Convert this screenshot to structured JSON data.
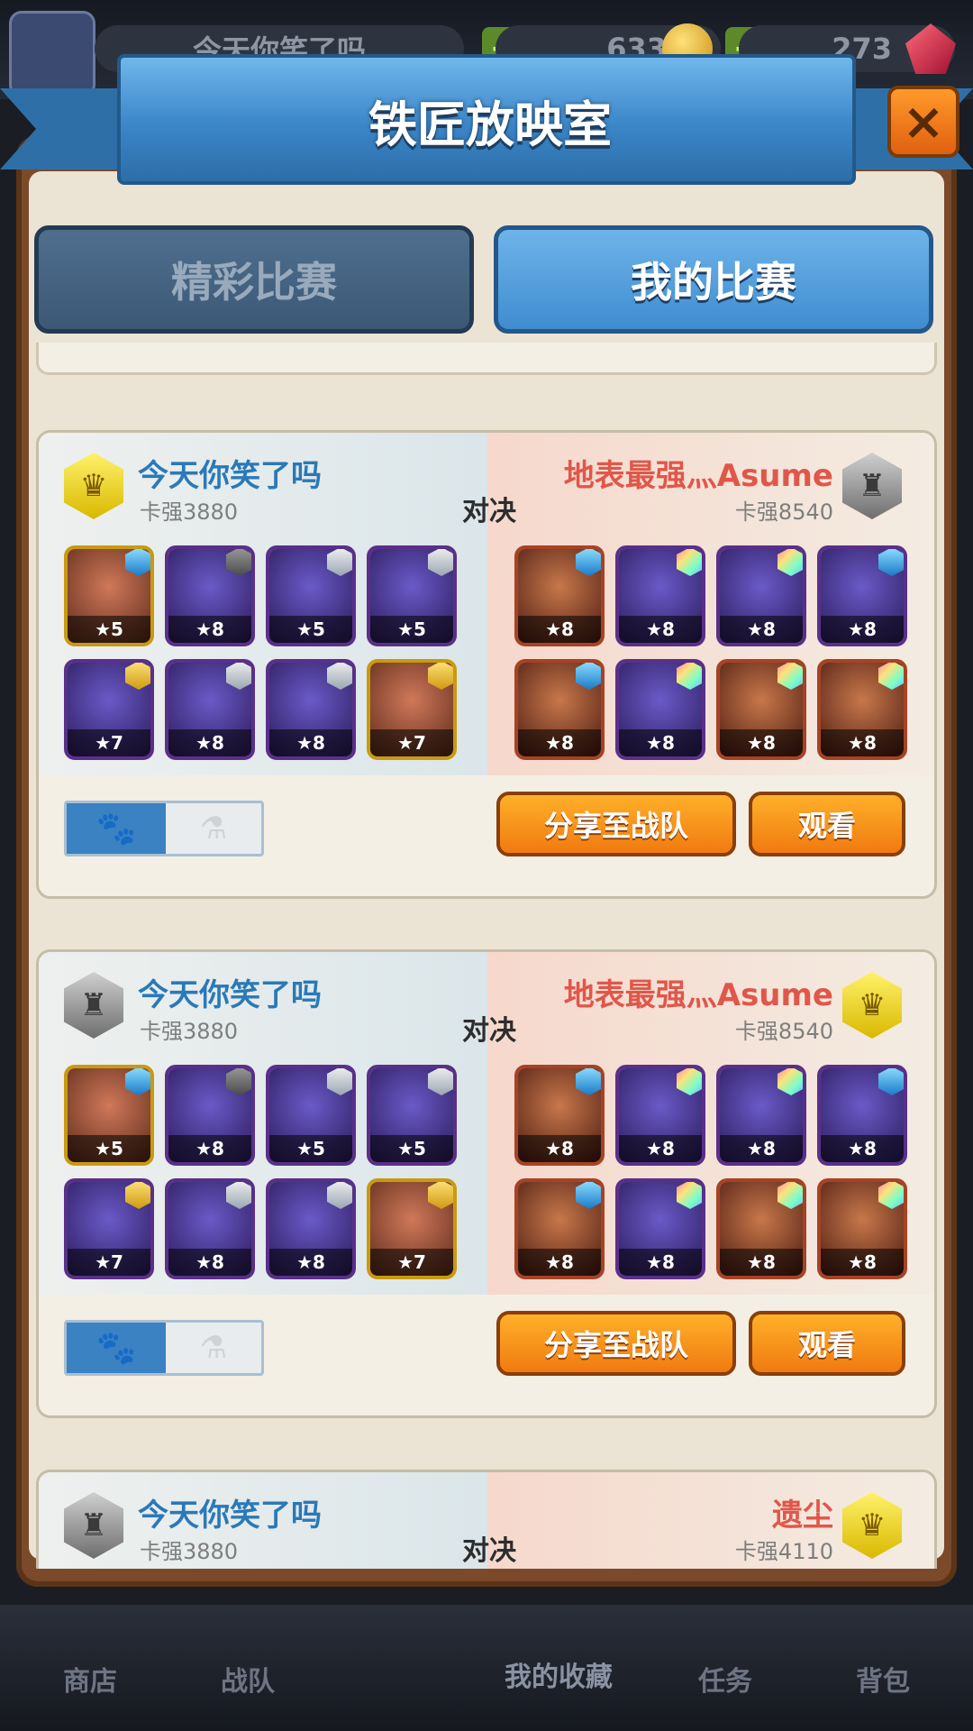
{
  "hud": {
    "player_name": "今天你笑了吗",
    "gold": "633",
    "gems": "273"
  },
  "window": {
    "title": "铁匠放映室",
    "close_icon": "×"
  },
  "tabs": [
    {
      "label": "精彩比赛",
      "active": false
    },
    {
      "label": "我的比赛",
      "active": true
    }
  ],
  "matches": [
    {
      "left": {
        "name": "今天你笑了吗",
        "power": "卡强3880",
        "badge": "gold-crown",
        "heroes": [
          {
            "level": "★5",
            "frame": "gold",
            "gem": "blue-star"
          },
          {
            "level": "★8",
            "frame": "purple",
            "gem": "gray"
          },
          {
            "level": "★5",
            "frame": "purple",
            "gem": "silver"
          },
          {
            "level": "★5",
            "frame": "purple",
            "gem": "silver"
          },
          {
            "level": "★7",
            "frame": "purple",
            "gem": "gold"
          },
          {
            "level": "★8",
            "frame": "purple",
            "gem": "silver"
          },
          {
            "level": "★8",
            "frame": "purple",
            "gem": "silver"
          },
          {
            "level": "★7",
            "frame": "gold",
            "gem": "gold"
          }
        ]
      },
      "vs": "对决",
      "right": {
        "name": "地表最强灬Asume",
        "power": "卡强8540",
        "badge": "silver-wings",
        "heroes": [
          {
            "level": "★8",
            "frame": "red",
            "gem": "blue-star"
          },
          {
            "level": "★8",
            "frame": "purple",
            "gem": "rainbow"
          },
          {
            "level": "★8",
            "frame": "purple",
            "gem": "rainbow"
          },
          {
            "level": "★8",
            "frame": "purple",
            "gem": "blue-star"
          },
          {
            "level": "★8",
            "frame": "red",
            "gem": "blue-star"
          },
          {
            "level": "★8",
            "frame": "purple",
            "gem": "rainbow"
          },
          {
            "level": "★8",
            "frame": "red",
            "gem": "rainbow"
          },
          {
            "level": "★8",
            "frame": "red",
            "gem": "rainbow"
          }
        ]
      },
      "toggle": {
        "on_icon": "paw-icon",
        "off_icon": "potion-icon"
      },
      "share_label": "分享至战队",
      "watch_label": "观看"
    },
    {
      "left": {
        "name": "今天你笑了吗",
        "power": "卡强3880",
        "badge": "silver-wings",
        "heroes": [
          {
            "level": "★5",
            "frame": "gold",
            "gem": "blue-star"
          },
          {
            "level": "★8",
            "frame": "purple",
            "gem": "gray"
          },
          {
            "level": "★5",
            "frame": "purple",
            "gem": "silver"
          },
          {
            "level": "★5",
            "frame": "purple",
            "gem": "silver"
          },
          {
            "level": "★7",
            "frame": "purple",
            "gem": "gold"
          },
          {
            "level": "★8",
            "frame": "purple",
            "gem": "silver"
          },
          {
            "level": "★8",
            "frame": "purple",
            "gem": "silver"
          },
          {
            "level": "★7",
            "frame": "gold",
            "gem": "gold"
          }
        ]
      },
      "vs": "对决",
      "right": {
        "name": "地表最强灬Asume",
        "power": "卡强8540",
        "badge": "gold-crown",
        "heroes": [
          {
            "level": "★8",
            "frame": "red",
            "gem": "blue-star"
          },
          {
            "level": "★8",
            "frame": "purple",
            "gem": "rainbow"
          },
          {
            "level": "★8",
            "frame": "purple",
            "gem": "rainbow"
          },
          {
            "level": "★8",
            "frame": "purple",
            "gem": "blue-star"
          },
          {
            "level": "★8",
            "frame": "red",
            "gem": "blue-star"
          },
          {
            "level": "★8",
            "frame": "purple",
            "gem": "rainbow"
          },
          {
            "level": "★8",
            "frame": "red",
            "gem": "rainbow"
          },
          {
            "level": "★8",
            "frame": "red",
            "gem": "rainbow"
          }
        ]
      },
      "toggle": {
        "on_icon": "paw-icon",
        "off_icon": "potion-icon"
      },
      "share_label": "分享至战队",
      "watch_label": "观看"
    },
    {
      "left": {
        "name": "今天你笑了吗",
        "power": "卡强3880",
        "badge": "silver-wings"
      },
      "vs": "对决",
      "right": {
        "name": "遗尘",
        "power": "卡强4110",
        "badge": "gold-crown"
      }
    }
  ],
  "bottom_nav": [
    {
      "label": "商店"
    },
    {
      "label": "战队"
    },
    {
      "label": "我的收藏"
    },
    {
      "label": "任务"
    },
    {
      "label": "背包"
    }
  ],
  "colors": {
    "left_name": "#2a79b8",
    "right_name": "#e0574a",
    "accent_orange": "#f07a10",
    "tab_active": "#3f8ccf"
  }
}
